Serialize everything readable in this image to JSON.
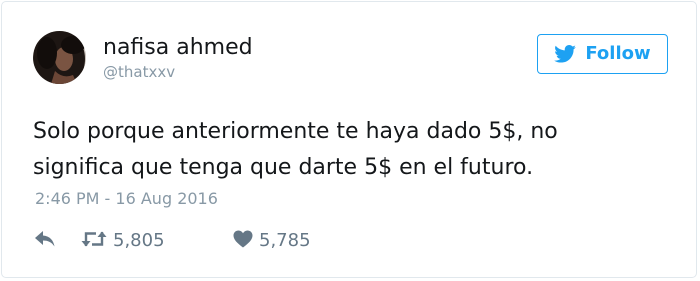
{
  "user": {
    "display_name": "nafisa ahmed",
    "handle": "@thatxxv"
  },
  "follow_button": {
    "label": "Follow",
    "icon": "twitter-bird-icon"
  },
  "tweet": {
    "text_lines": [
      "Solo porque anteriormente te haya dado 5$, no",
      "significa que tenga que darte 5$ en el futuro."
    ],
    "timestamp": "2:46 PM - 16 Aug 2016"
  },
  "actions": {
    "reply_icon": "reply-arrow-icon",
    "retweet_icon": "retweet-icon",
    "retweet_count": "5,805",
    "like_icon": "heart-icon",
    "like_count": "5,785"
  },
  "colors": {
    "accent": "#1da1f2",
    "text": "#14171a",
    "muted": "#8899a6",
    "action": "#657786",
    "border": "#e1e8ed"
  }
}
